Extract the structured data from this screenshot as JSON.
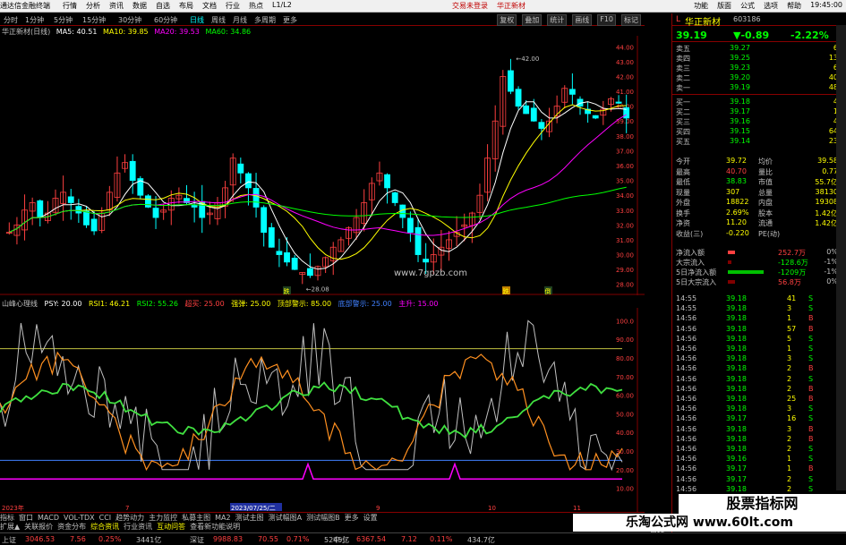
{
  "topbar": {
    "app": "通达信金融终端",
    "menus": [
      "行情",
      "分析",
      "资讯",
      "数据",
      "自选",
      "布局",
      "文档",
      "行业",
      "热点",
      "L1/L2"
    ],
    "center": [
      "交易未登录",
      "华正新材"
    ],
    "right": [
      "功能",
      "版面",
      "公式",
      "选项",
      "帮助"
    ]
  },
  "period_bar": {
    "items": [
      "分时",
      "1分钟",
      "5分钟",
      "15分钟",
      "30分钟",
      "60分钟",
      "日线",
      "周线",
      "月线",
      "多周期",
      "更多"
    ],
    "active": "日线",
    "tools": [
      "复权",
      "叠加",
      "统计",
      "画线",
      "F10",
      "标记"
    ]
  },
  "main_legend": {
    "name": "华正新材(日线)",
    "ma5": "MA5: 40.51",
    "ma10": "MA10: 39.85",
    "ma20": "MA20: 39.53",
    "ma60": "MA60: 34.86",
    "high_label": "42.00",
    "low_label": "28.08",
    "site": "www.7gpzb.com",
    "colors": {
      "ma5": "#ffffff",
      "ma10": "#ffff00",
      "ma20": "#ff00ff",
      "ma60": "#00ff00"
    }
  },
  "price_axis": [
    "44.00",
    "43.00",
    "42.00",
    "41.00",
    "40.00",
    "39.00",
    "38.00",
    "37.00",
    "36.00",
    "35.00",
    "34.00",
    "33.00",
    "32.00",
    "31.00",
    "30.00",
    "29.00",
    "28.00"
  ],
  "sub_legend": {
    "name": "山峰心理线",
    "psy": "PSY: 20.00",
    "rsi1": "RSI1: 46.21",
    "rsi2": "RSI2: 55.26",
    "l1": "超买: 25.00",
    "l2": "强弹: 25.00",
    "l3": "顶部警示: 85.00",
    "l4": "底部警示: 25.00",
    "l5": "主升: 15.00"
  },
  "sub_axis": [
    "100.0",
    "90.00",
    "80.00",
    "70.00",
    "60.00",
    "50.00",
    "40.00",
    "30.00",
    "20.00",
    "10.00"
  ],
  "date_labels": [
    "2023年",
    "7",
    "2023/07/25/二",
    "9",
    "10",
    "11"
  ],
  "marker_labels": [
    "跌",
    "跌",
    "倒"
  ],
  "bottom_tabs": [
    "指标",
    "窗口",
    "MACD",
    "VOL-TDX",
    "CCI",
    "趋势动力",
    "主力监控",
    "私募主图",
    "MA2",
    "测试主图",
    "测试幅图A",
    "测试幅图B",
    "更多",
    "设置"
  ],
  "bottom_tabs2": [
    "扩展▲",
    "关联报价",
    "资金分布",
    "综合资讯",
    "行业资讯",
    "互动问答",
    "查看新功能说明"
  ],
  "side_tab": "日线",
  "index_bar": [
    {
      "name": "上证",
      "value": "3046.53",
      "chg": "7.56",
      "pct": "0.25%",
      "vol": "3441亿"
    },
    {
      "name": "深证",
      "value": "9988.83",
      "chg": "70.55",
      "pct": "0.71%",
      "vol": "5245亿"
    },
    {
      "name": "中小",
      "value": "6367.54",
      "chg": "7.12",
      "pct": "0.11%",
      "vol": "434.7亿"
    }
  ],
  "stock": {
    "name": "华正新材",
    "code": "603186",
    "price": "39.19",
    "change": "▼-0.89",
    "pct": "-2.22%",
    "sell": [
      [
        "卖五",
        "39.27",
        "6"
      ],
      [
        "卖四",
        "39.25",
        "13"
      ],
      [
        "卖三",
        "39.23",
        "6"
      ],
      [
        "卖二",
        "39.20",
        "40"
      ],
      [
        "卖一",
        "39.19",
        "48"
      ]
    ],
    "buy": [
      [
        "买一",
        "39.18",
        "4"
      ],
      [
        "买二",
        "39.17",
        "1"
      ],
      [
        "买三",
        "39.16",
        "4"
      ],
      [
        "买四",
        "39.15",
        "64"
      ],
      [
        "买五",
        "39.14",
        "23"
      ]
    ],
    "stats": [
      [
        "今开",
        "39.72",
        "均价",
        "39.58"
      ],
      [
        "最高",
        "40.70",
        "量比",
        "0.77"
      ],
      [
        "最低",
        "38.83",
        "市值",
        "55.7亿"
      ],
      [
        "现量",
        "307",
        "总量",
        "38130"
      ],
      [
        "外盘",
        "18822",
        "内盘",
        "19308"
      ],
      [
        "换手",
        "2.69%",
        "股本",
        "1.42亿"
      ],
      [
        "净资",
        "11.20",
        "流通",
        "1.42亿"
      ],
      [
        "收益(三)",
        "-0.220",
        "PE(动)",
        ""
      ]
    ],
    "flows": [
      [
        "净流入额",
        "252.7万",
        "0%"
      ],
      [
        "大宗流入",
        "-128.6万",
        "-1%"
      ],
      [
        "5日净流入额",
        "-1209万",
        "-1%"
      ],
      [
        "5日大宗流入",
        "56.8万",
        "0%"
      ]
    ],
    "ticks": [
      [
        "14:55",
        "39.18",
        "41",
        "S"
      ],
      [
        "14:55",
        "39.18",
        "3",
        "S"
      ],
      [
        "14:56",
        "39.18",
        "1",
        "B"
      ],
      [
        "14:56",
        "39.18",
        "57",
        "B"
      ],
      [
        "14:56",
        "39.18",
        "5",
        "S"
      ],
      [
        "14:56",
        "39.18",
        "1",
        "S"
      ],
      [
        "14:56",
        "39.18",
        "3",
        "S"
      ],
      [
        "14:56",
        "39.18",
        "2",
        "B"
      ],
      [
        "14:56",
        "39.18",
        "2",
        "S"
      ],
      [
        "14:56",
        "39.18",
        "2",
        "B"
      ],
      [
        "14:56",
        "39.18",
        "25",
        "B"
      ],
      [
        "14:56",
        "39.18",
        "3",
        "S"
      ],
      [
        "14:56",
        "39.17",
        "16",
        "S"
      ],
      [
        "14:56",
        "39.18",
        "3",
        "B"
      ],
      [
        "14:56",
        "39.18",
        "2",
        "B"
      ],
      [
        "14:56",
        "39.18",
        "2",
        "S"
      ],
      [
        "14:56",
        "39.16",
        "1",
        "S"
      ],
      [
        "14:56",
        "39.17",
        "1",
        "B"
      ],
      [
        "14:56",
        "39.17",
        "2",
        "S"
      ],
      [
        "14:56",
        "39.18",
        "2",
        "S"
      ]
    ]
  },
  "watermarks": {
    "w1": "股票指标网",
    "w2": "乐淘公式网 www.60lt.com"
  },
  "time": "19:45:00"
}
